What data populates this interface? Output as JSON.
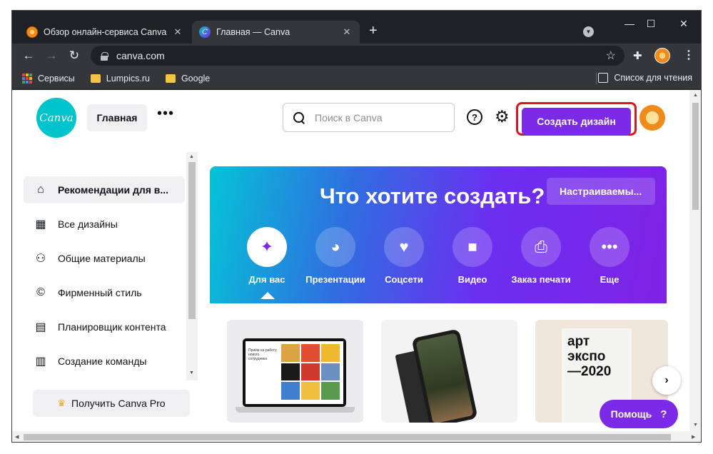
{
  "browser": {
    "tabs": [
      {
        "title": "Обзор онлайн-сервиса Canva",
        "close": "✕"
      },
      {
        "title": "Главная — Canva",
        "close": "✕"
      }
    ],
    "new_tab": "+",
    "window_controls": {
      "minimize": "—",
      "maximize": "☐",
      "close": "✕"
    },
    "url": "canva.com",
    "bookmarks": [
      {
        "label": "Сервисы",
        "icon": "apps-grid-icon"
      },
      {
        "label": "Lumpics.ru",
        "icon": "folder-icon"
      },
      {
        "label": "Google",
        "icon": "folder-icon"
      }
    ],
    "reading_list": "Список для чтения"
  },
  "header": {
    "logo_text": "Canva",
    "home_label": "Главная",
    "more_label": "•••",
    "search_placeholder": "Поиск в Canva",
    "help_label": "?",
    "create_label": "Создать дизайн",
    "highlight_color": "#e0141c",
    "accent_color": "#7d2ae8"
  },
  "sidebar": {
    "items": [
      {
        "label": "Рекомендации для в...",
        "icon": "home-icon",
        "glyph": "⌂",
        "active": true
      },
      {
        "label": "Все дизайны",
        "icon": "grid-icon",
        "glyph": "▦",
        "active": false
      },
      {
        "label": "Общие материалы",
        "icon": "shared-people-icon",
        "glyph": "⚇",
        "active": false
      },
      {
        "label": "Фирменный стиль",
        "icon": "brand-icon",
        "glyph": "©",
        "active": false
      },
      {
        "label": "Планировщик контента",
        "icon": "calendar-icon",
        "glyph": "▤",
        "active": false
      },
      {
        "label": "Создание команды",
        "icon": "team-building-icon",
        "glyph": "▥",
        "active": false
      }
    ],
    "pro_label": "Получить Canva Pro"
  },
  "hero": {
    "title": "Что хотите создать?",
    "custom_size_label": "Настраиваемы...",
    "categories": [
      {
        "label": "Для вас",
        "icon": "sparkle-icon",
        "glyph": "✦",
        "active": true
      },
      {
        "label": "Презентации",
        "icon": "presentation-icon",
        "glyph": "◕",
        "active": false
      },
      {
        "label": "Соцсети",
        "icon": "heart-icon",
        "glyph": "♥",
        "active": false
      },
      {
        "label": "Видео",
        "icon": "video-icon",
        "glyph": "■",
        "active": false
      },
      {
        "label": "Заказ печати",
        "icon": "printer-icon",
        "glyph": "⎙",
        "active": false
      },
      {
        "label": "Еще",
        "icon": "more-icon",
        "glyph": "•••",
        "active": false
      }
    ]
  },
  "cards": {
    "laptop_text": "Приём на работу нового сотрудника",
    "poster_lines": [
      "арт",
      "экспо",
      "—2020"
    ]
  },
  "help_button": {
    "label": "Помощь",
    "q": "?"
  }
}
